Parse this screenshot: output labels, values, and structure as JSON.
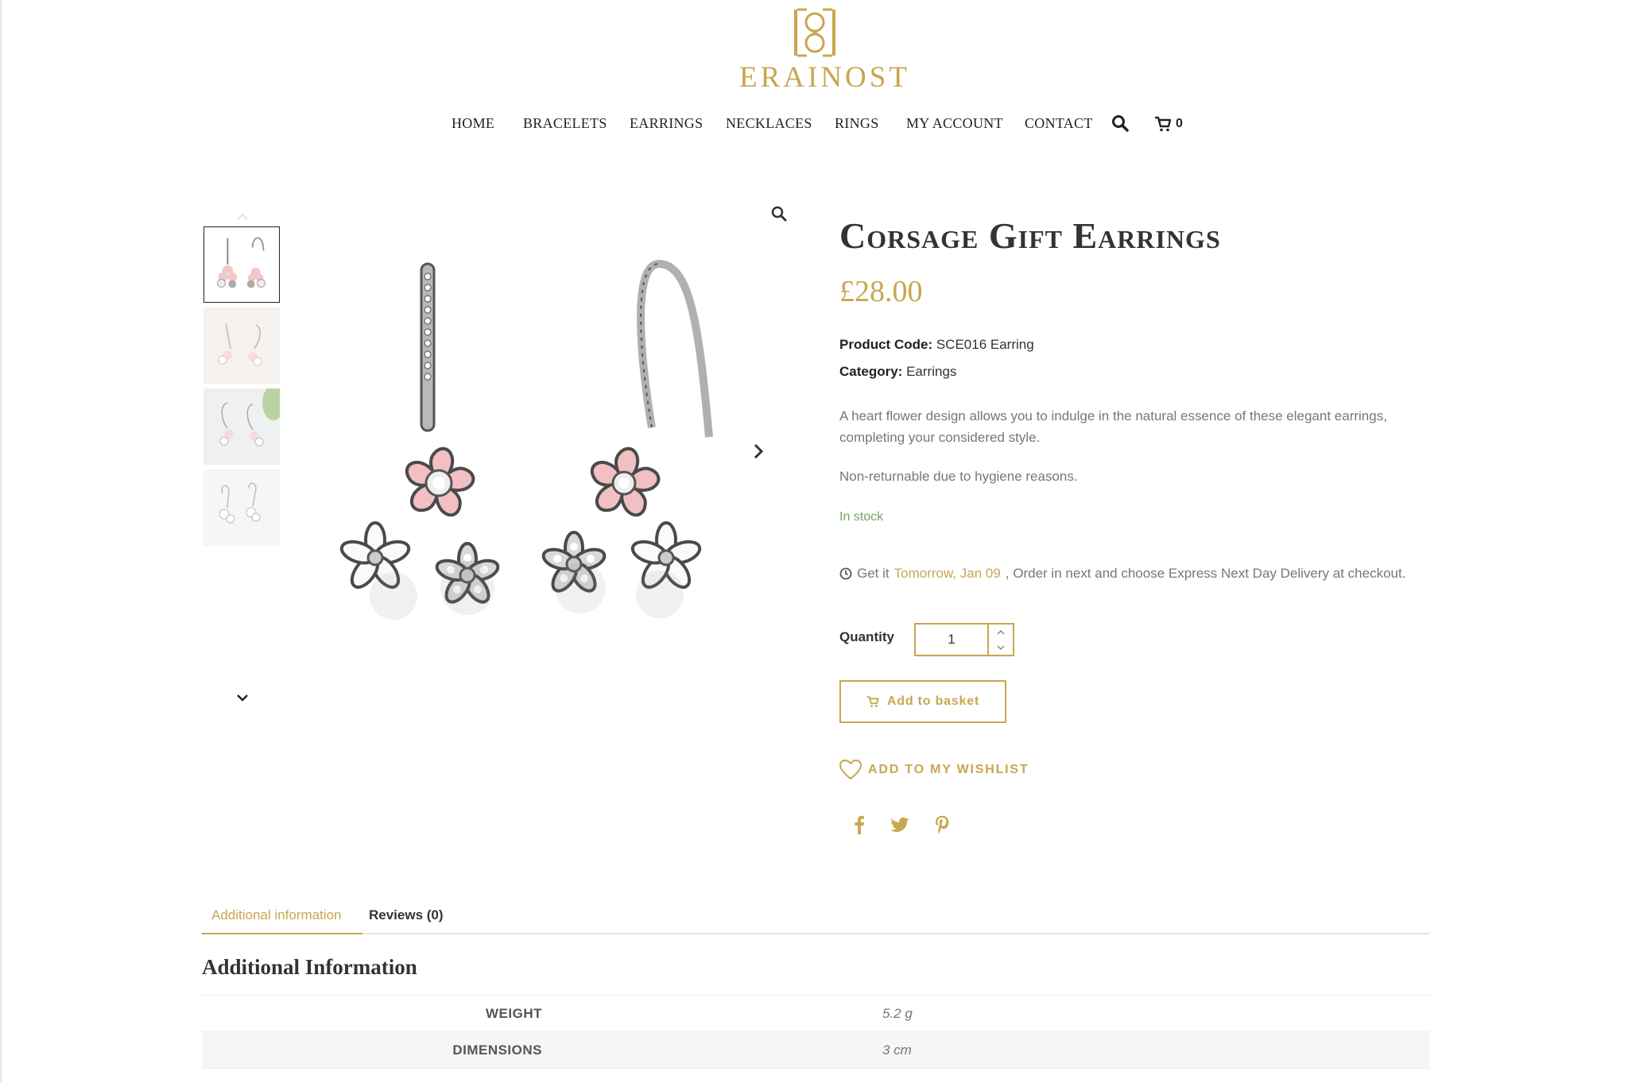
{
  "brand": {
    "name": "ERAINOST",
    "accent_color": "#c9a650"
  },
  "nav": {
    "items": [
      "HOME",
      "BRACELETS",
      "EARRINGS",
      "NECKLACES",
      "RINGS",
      "MY ACCOUNT",
      "CONTACT"
    ],
    "search_icon": "search-icon",
    "cart_icon": "cart-icon",
    "cart_count": "0"
  },
  "gallery": {
    "thumbnails": [
      "thumbnail-1",
      "thumbnail-2",
      "thumbnail-3",
      "thumbnail-4"
    ],
    "active_thumbnail": 0
  },
  "product": {
    "title": "Corsage Gift Earrings",
    "price": "£28.00",
    "code_label": "Product Code:",
    "code": "SCE016 Earring",
    "category_label": "Category:",
    "category": "Earrings",
    "description": "A heart flower design allows you to indulge in the natural essence of these elegant earrings, completing your considered style.",
    "returns_note": "Non-returnable due to hygiene reasons.",
    "stock": "In stock",
    "delivery_prefix": "Get it",
    "delivery_date": "Tomorrow, Jan 09",
    "delivery_suffix": ", Order in next and choose Express Next Day Delivery at checkout.",
    "quantity_label": "Quantity",
    "quantity": "1",
    "add_to_basket": "Add to basket",
    "wishlist": "ADD TO MY WISHLIST"
  },
  "social": [
    "facebook-icon",
    "twitter-icon",
    "pinterest-icon"
  ],
  "tabs": [
    {
      "label": "Additional information",
      "active": true
    },
    {
      "label": "Reviews (0)",
      "active": false
    }
  ],
  "additional_info": {
    "title": "Additional Information",
    "rows": [
      {
        "name": "WEIGHT",
        "value": "5.2 g"
      },
      {
        "name": "DIMENSIONS",
        "value": "3 cm"
      }
    ]
  }
}
